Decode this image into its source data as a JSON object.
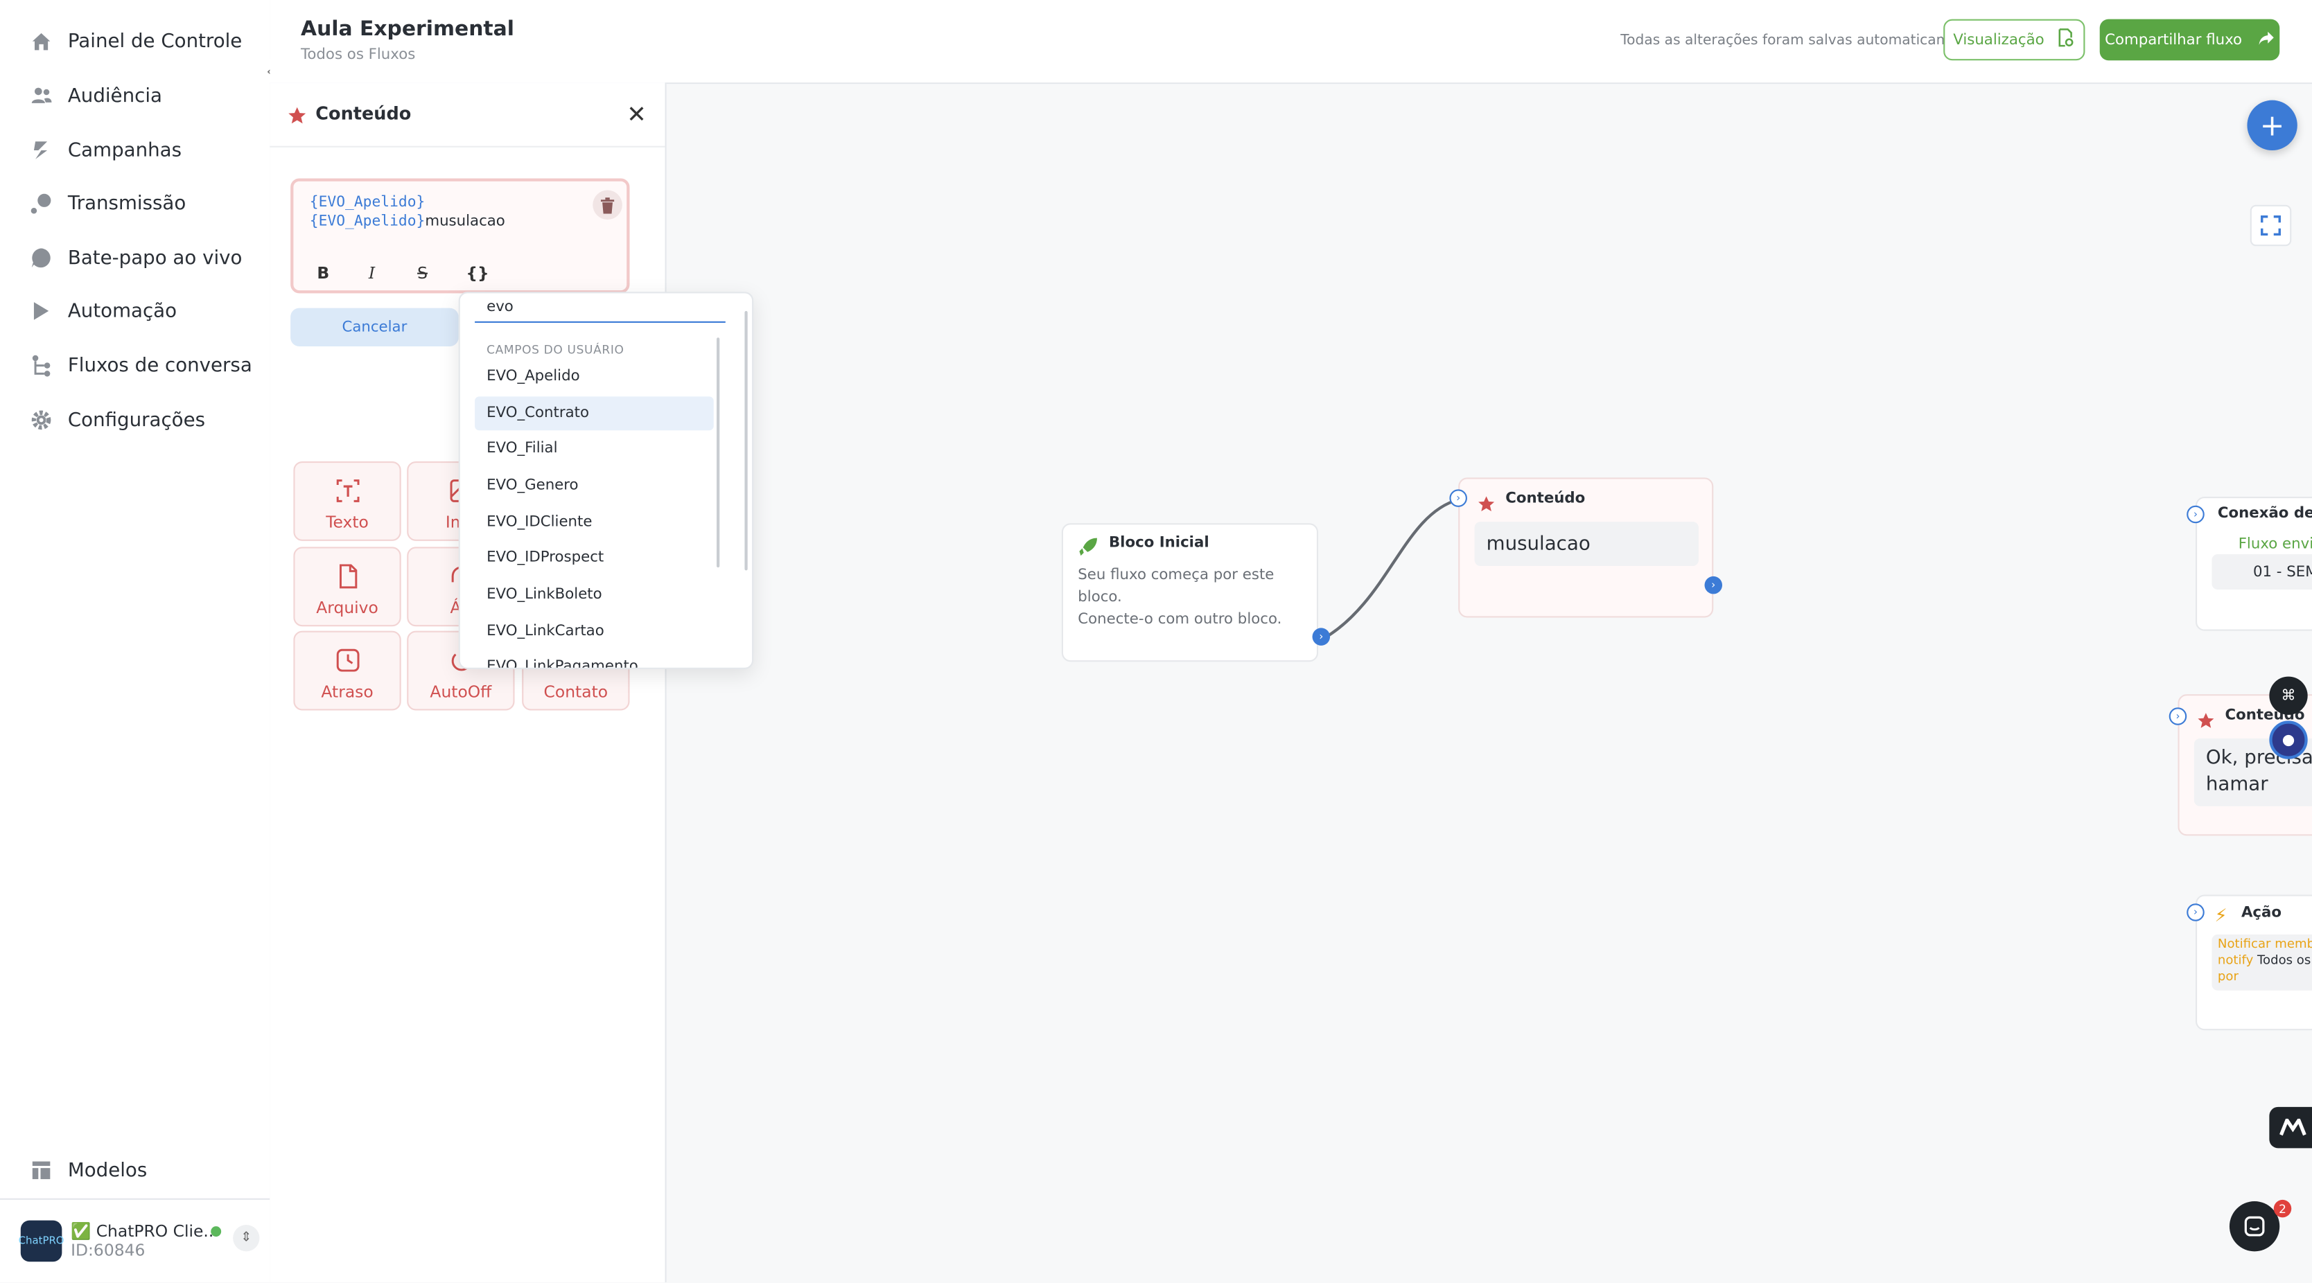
{
  "sidebar": {
    "items": [
      {
        "label": "Painel de Controle",
        "icon": "home-icon"
      },
      {
        "label": "Audiência",
        "icon": "users-icon"
      },
      {
        "label": "Campanhas",
        "icon": "campaigns-icon"
      },
      {
        "label": "Transmissão",
        "icon": "broadcast-icon"
      },
      {
        "label": "Bate-papo ao vivo",
        "icon": "chat-icon"
      },
      {
        "label": "Automação",
        "icon": "automation-icon"
      },
      {
        "label": "Fluxos de conversa",
        "icon": "flow-icon"
      },
      {
        "label": "Configurações",
        "icon": "gear-icon"
      }
    ],
    "templates_label": "Modelos",
    "workspace": {
      "name": "✅ ChatPRO Clie...",
      "id": "ID:60846",
      "avatar_text": "ChatPRO"
    }
  },
  "header": {
    "title": "Aula Experimental",
    "breadcrumb": "Todos os Fluxos",
    "autosave": "Todas as alterações foram salvas automaticamente",
    "preview_label": "Visualização",
    "share_label": "Compartilhar fluxo"
  },
  "panel": {
    "title": "Conteúdo",
    "editor": {
      "token1": "{EVO_Apelido}",
      "token2": "{EVO_Apelido}",
      "text": "musulacao"
    },
    "format_buttons": [
      "B",
      "I",
      "S",
      "{}"
    ],
    "cancel_label": "Cancelar",
    "tiles": [
      "Texto",
      "Ima",
      "Arquivo",
      "Áu",
      "Atraso",
      "AutoOff",
      "Contato"
    ]
  },
  "dropdown": {
    "search_value": "evo",
    "group_label": "CAMPOS DO USUÁRIO",
    "items": [
      "EVO_Apelido",
      "EVO_Contrato",
      "EVO_Filial",
      "EVO_Genero",
      "EVO_IDCliente",
      "EVO_IDProspect",
      "EVO_LinkBoleto",
      "EVO_LinkCartao",
      "EVO_LinkPagamento"
    ],
    "selected": "EVO_Contrato"
  },
  "canvas": {
    "start_node": {
      "title": "Bloco Inicial",
      "body_line1": "Seu fluxo começa por este bloco.",
      "body_line2": "Conecte-o com outro bloco."
    },
    "content_node": {
      "title": "Conteúdo",
      "message": "musulacao"
    },
    "connection_node": {
      "title": "Conexão de Fl",
      "status": "Fluxo envia",
      "target": "01 - SEM"
    },
    "content_node2": {
      "title": "Conteúdo",
      "message_line1": "Ok, precisa",
      "message_line2": "hamar"
    },
    "action_node": {
      "title": "Ação",
      "line1": "Notificar membro",
      "line2_prefix": "notify",
      "line2_value": "Todos os",
      "line3": "por"
    },
    "chat_badge": "2"
  },
  "colors": {
    "accent": "#3c7bd6",
    "brand_green": "#5aa644",
    "content_red": "#d05050"
  }
}
